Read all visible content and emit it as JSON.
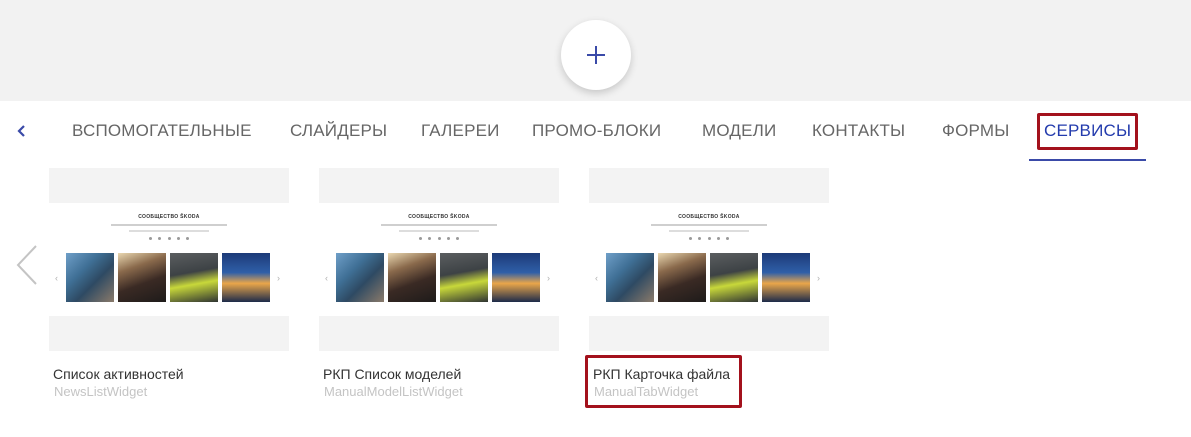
{
  "header": {
    "add_icon": "plus-icon"
  },
  "tabs": {
    "prev_icon": "chevron-left-icon",
    "items": [
      {
        "label": "ВСПОМОГАТЕЛЬНЫЕ",
        "active": false
      },
      {
        "label": "СЛАЙДЕРЫ",
        "active": false
      },
      {
        "label": "ГАЛЕРЕИ",
        "active": false
      },
      {
        "label": "ПРОМО-БЛОКИ",
        "active": false
      },
      {
        "label": "МОДЕЛИ",
        "active": false
      },
      {
        "label": "КОНТАКТЫ",
        "active": false
      },
      {
        "label": "ФОРМЫ",
        "active": false
      },
      {
        "label": "СЕРВИСЫ",
        "active": true
      }
    ],
    "active_color": "#233bad",
    "highlight_color": "#a3111c"
  },
  "cards": {
    "prev_icon": "chevron-left-icon",
    "thumbnail_title": "СООБЩЕСТВО ŠKODA",
    "items": [
      {
        "title": "Список активностей",
        "widget": "NewsListWidget"
      },
      {
        "title": "РКП Список моделей",
        "widget": "ManualModelListWidget"
      },
      {
        "title": "РКП Карточка файла",
        "widget": "ManualTabWidget",
        "highlighted": true
      }
    ]
  }
}
